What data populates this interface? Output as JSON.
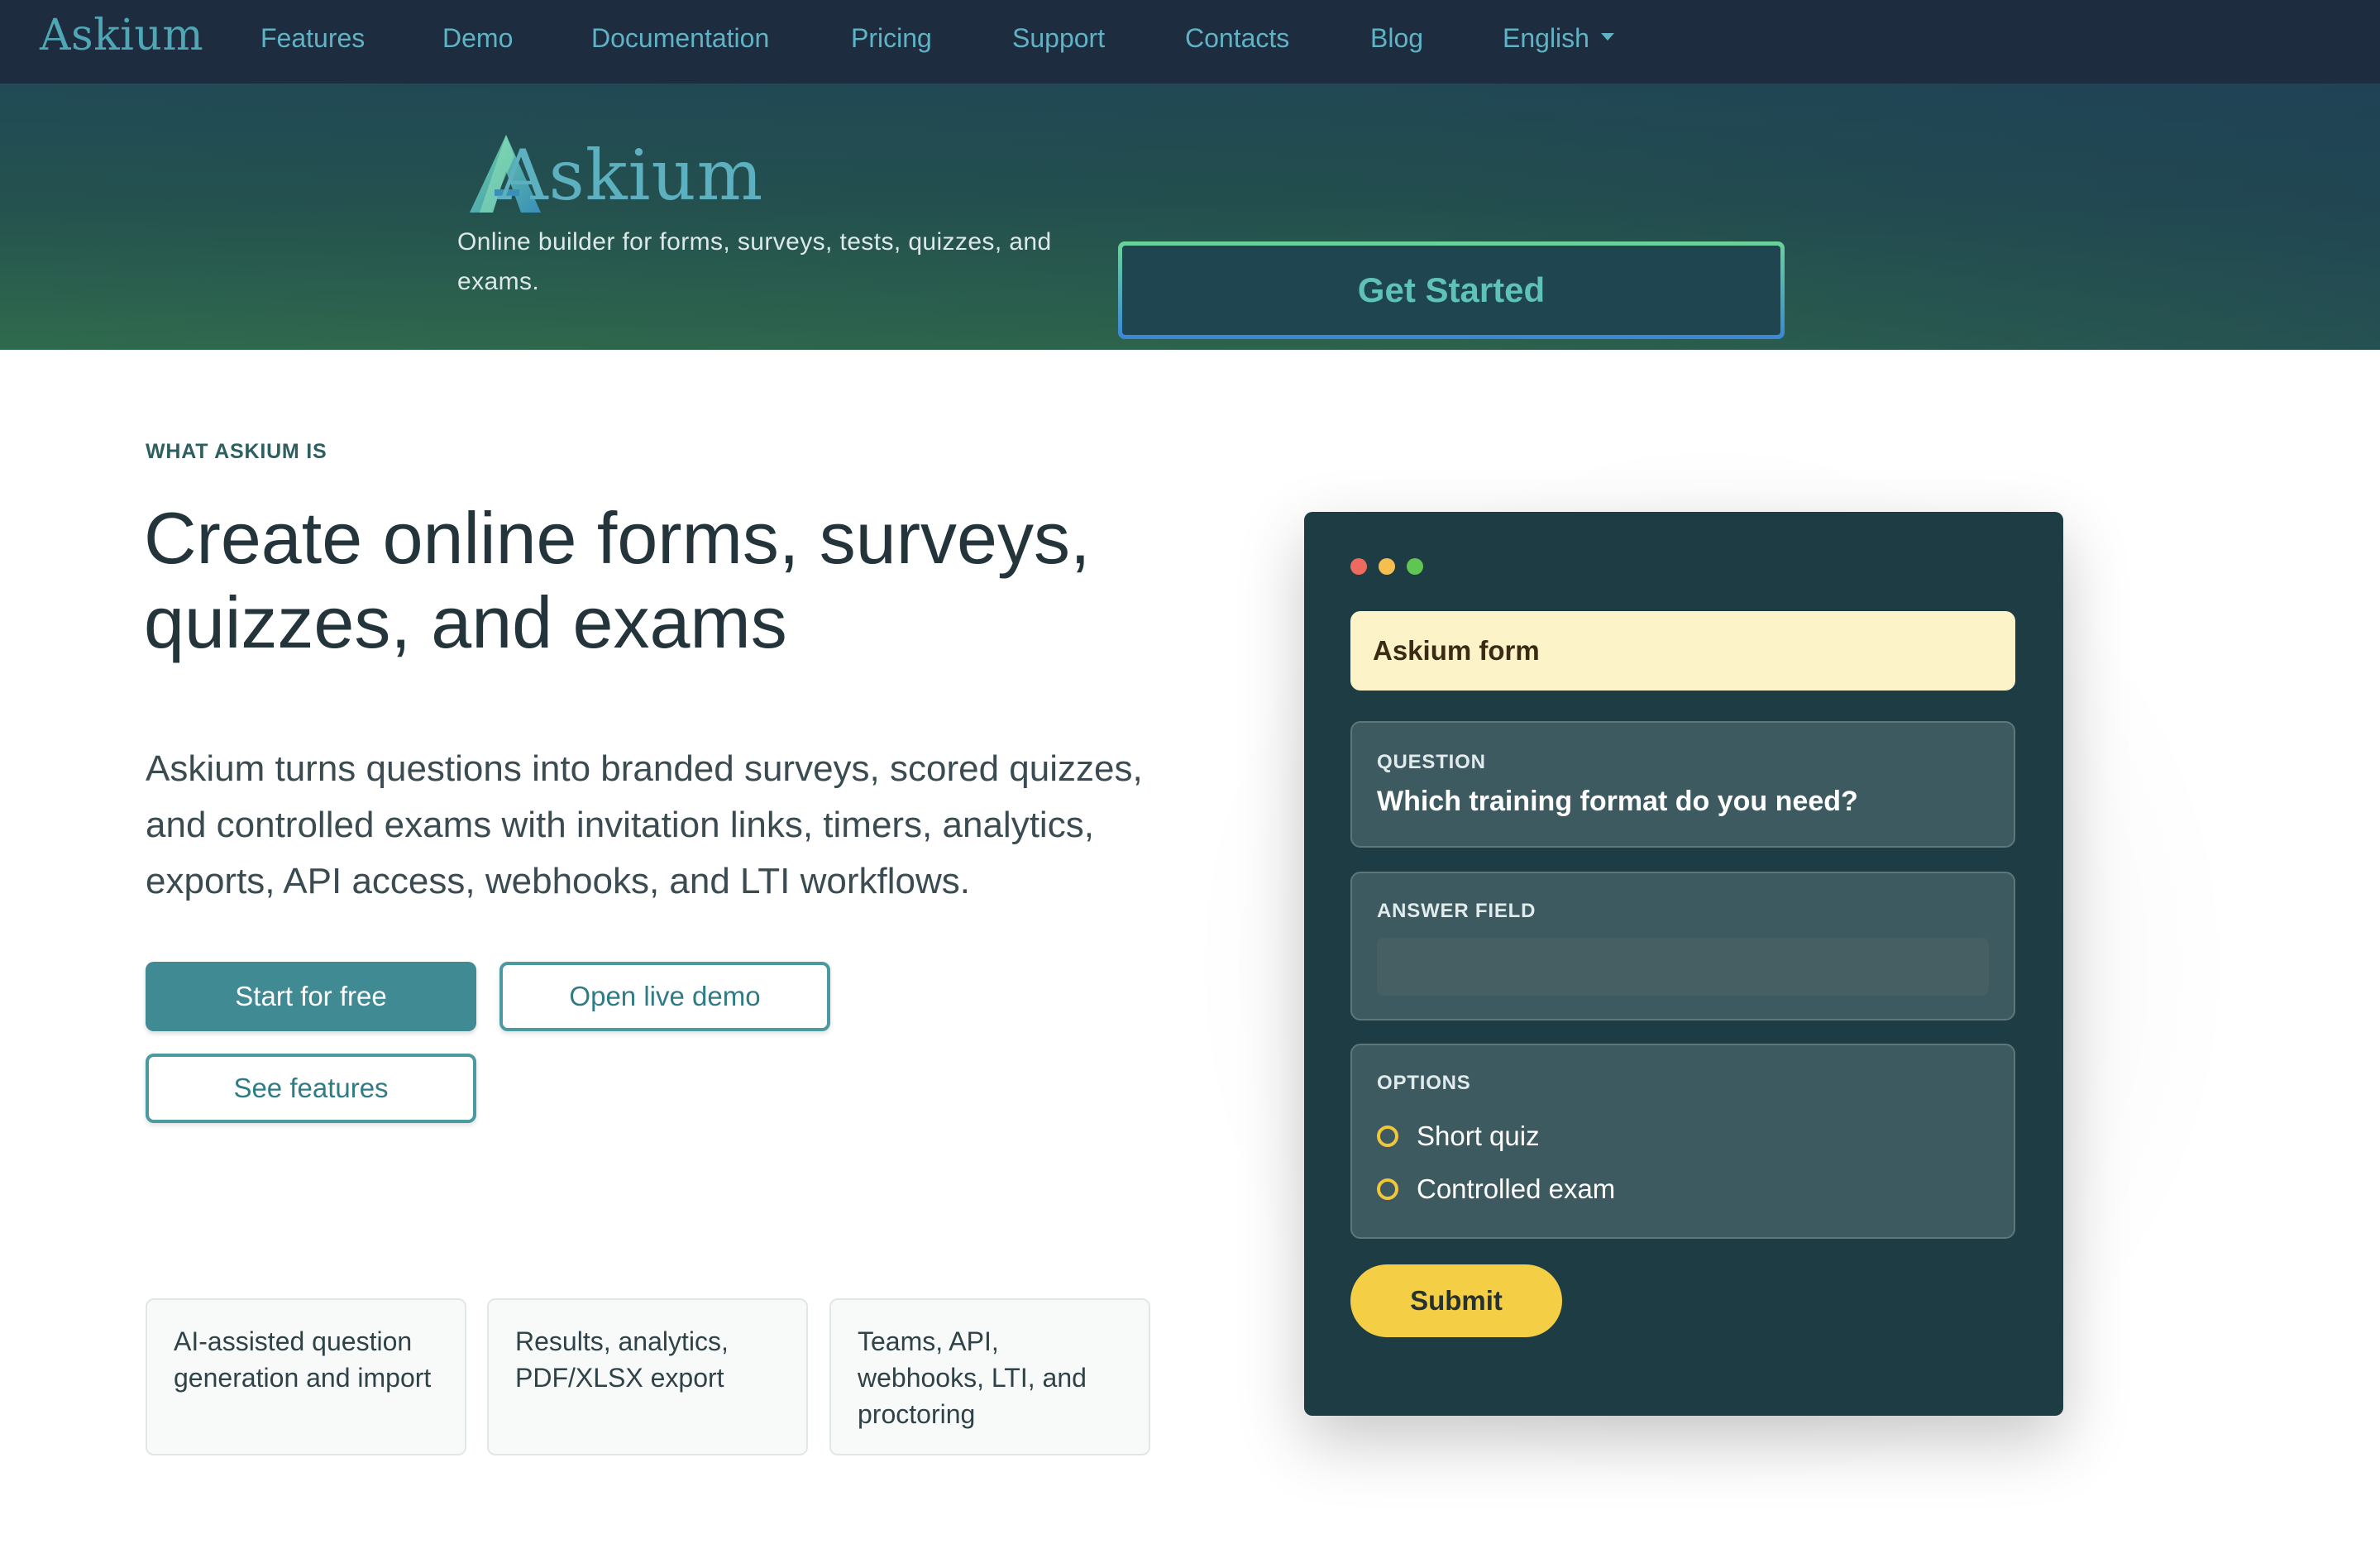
{
  "colors": {
    "nav_bg": "#1e2c40",
    "nav_link": "#5fb3c4",
    "accent_teal": "#3f8a93",
    "panel_bg": "#1e3c44",
    "submit_yellow": "#f4cf45",
    "window_dot_red": "#ec6a5e",
    "window_dot_yellow": "#f4bf4f",
    "window_dot_green": "#61c554"
  },
  "nav": {
    "logo": "Askium",
    "links": [
      "Features",
      "Demo",
      "Documentation",
      "Pricing",
      "Support",
      "Contacts",
      "Blog"
    ],
    "language": "English"
  },
  "hero": {
    "logo": "Askium",
    "tagline": "Online builder for forms, surveys, tests, quizzes, and exams.",
    "cta": "Get Started"
  },
  "intro": {
    "eyebrow": "WHAT ASKIUM IS",
    "headline": "Create online forms, surveys, quizzes, and exams",
    "lead": "Askium turns questions into branded surveys, scored quizzes, and controlled exams with invitation links, timers, analytics, exports, API access, webhooks, and LTI workflows.",
    "buttons": {
      "start": "Start for free",
      "demo": "Open live demo",
      "features": "See features"
    },
    "features": [
      "AI-assisted question generation and import",
      "Results, analytics, PDF/XLSX export",
      "Teams, API, webhooks, LTI, and proctoring"
    ]
  },
  "form_preview": {
    "title": "Askium form",
    "question_label": "QUESTION",
    "question": "Which training format do you need?",
    "answer_label": "ANSWER FIELD",
    "answer_value": "",
    "options_label": "OPTIONS",
    "options": [
      "Short quiz",
      "Controlled exam"
    ],
    "submit": "Submit"
  }
}
